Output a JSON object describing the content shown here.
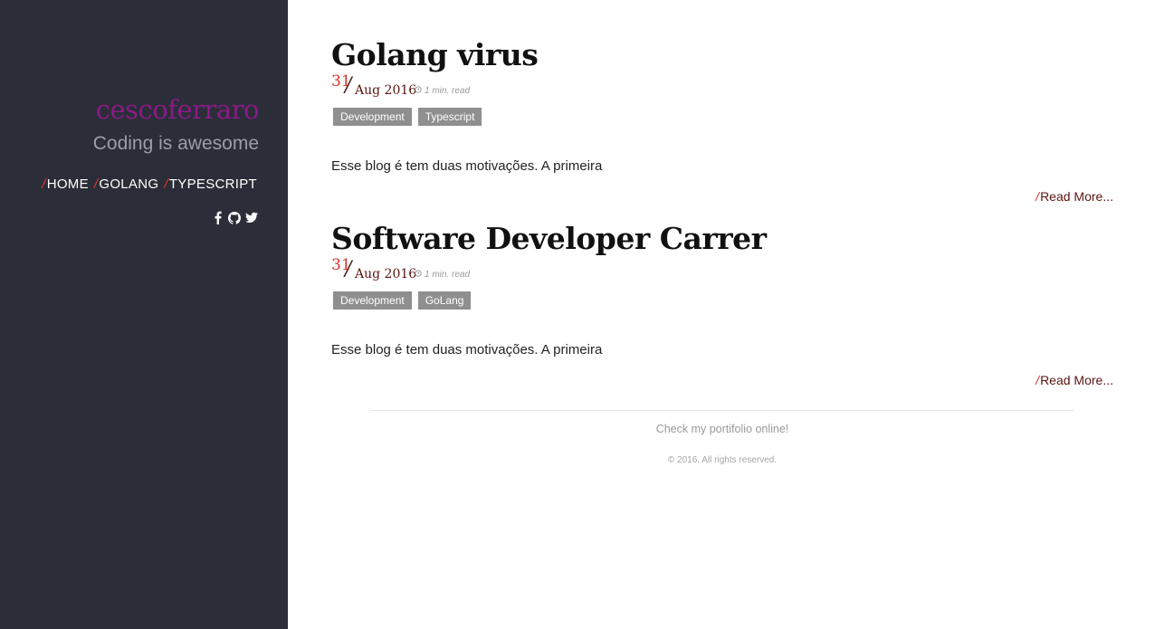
{
  "sidebar": {
    "site_title": "cescoferraro",
    "tagline": "Coding is awesome",
    "nav": [
      {
        "slash": "/",
        "label": "HOME"
      },
      {
        "slash": "/",
        "label": "GOLANG"
      },
      {
        "slash": "/",
        "label": "TYPESCRIPT"
      }
    ],
    "social_icons": [
      "facebook-icon",
      "github-icon",
      "twitter-icon"
    ]
  },
  "posts": [
    {
      "title": "Golang virus",
      "day": "31",
      "slash": "/",
      "month_year": "Aug 2016",
      "read_time": "1 min. read",
      "tags": [
        "Development",
        "Typescript"
      ],
      "excerpt": "Esse blog é tem duas motivações. A primeira",
      "read_more_slash": "/",
      "read_more": "Read More..."
    },
    {
      "title": "Software Developer Carrer",
      "day": "31",
      "slash": "/",
      "month_year": "Aug 2016",
      "read_time": "1 min. read",
      "tags": [
        "Development",
        "GoLang"
      ],
      "excerpt": "Esse blog é tem duas motivações. A primeira",
      "read_more_slash": "/",
      "read_more": "Read More..."
    }
  ],
  "footer": {
    "portfolio_link": "Check my portifolio online!",
    "copyright": "© 2016. All rights reserved."
  },
  "colors": {
    "sidebar_bg": "#2b2e38",
    "title_purple": "#8a1a86",
    "accent_red": "#d8312a",
    "tag_gray": "#8f8f8f",
    "date_dark_red": "#5a1512"
  }
}
